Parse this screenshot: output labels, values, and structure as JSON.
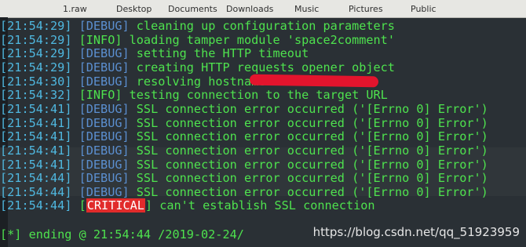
{
  "background_window": {
    "tabs": [
      "1.raw",
      "Desktop",
      "Documents",
      "Downloads",
      "Music",
      "Pictures",
      "Public"
    ]
  },
  "terminal": {
    "lines": [
      {
        "time": "21:54:29",
        "level": "DEBUG",
        "message": " cleaning up configuration parameters"
      },
      {
        "time": "21:54:29",
        "level": "INFO",
        "message": " loading tamper module 'space2comment'"
      },
      {
        "time": "21:54:29",
        "level": "DEBUG",
        "message": " setting the HTTP timeout"
      },
      {
        "time": "21:54:29",
        "level": "DEBUG",
        "message": " creating HTTP requests opener object"
      },
      {
        "time": "21:54:30",
        "level": "DEBUG",
        "message": " resolving hostname"
      },
      {
        "time": "21:54:32",
        "level": "INFO",
        "message": " testing connection to the target URL"
      },
      {
        "time": "21:54:41",
        "level": "DEBUG",
        "message": " SSL connection error occurred ('[Errno 0] Error')"
      },
      {
        "time": "21:54:41",
        "level": "DEBUG",
        "message": " SSL connection error occurred ('[Errno 0] Error')"
      },
      {
        "time": "21:54:41",
        "level": "DEBUG",
        "message": " SSL connection error occurred ('[Errno 0] Error')"
      },
      {
        "time": "21:54:41",
        "level": "DEBUG",
        "message": " SSL connection error occurred ('[Errno 0] Error')"
      },
      {
        "time": "21:54:41",
        "level": "DEBUG",
        "message": " SSL connection error occurred ('[Errno 0] Error')"
      },
      {
        "time": "21:54:44",
        "level": "DEBUG",
        "message": " SSL connection error occurred ('[Errno 0] Error')"
      },
      {
        "time": "21:54:44",
        "level": "DEBUG",
        "message": " SSL connection error occurred ('[Errno 0] Error')"
      },
      {
        "time": "21:54:44",
        "level": "CRITICAL",
        "message": " can't establish SSL connection"
      }
    ],
    "ending": "[*] ending @ 21:54:44 /2019-02-24/"
  },
  "watermark": "https://blog.csdn.net/qq_51923959",
  "colors": {
    "timestamp": "#4fb8e0",
    "debug": "#5b8fd0",
    "info": "#4ee24e",
    "message": "#4ee24e",
    "critical_bg": "#e12b2b",
    "redaction": "#e3142d"
  }
}
